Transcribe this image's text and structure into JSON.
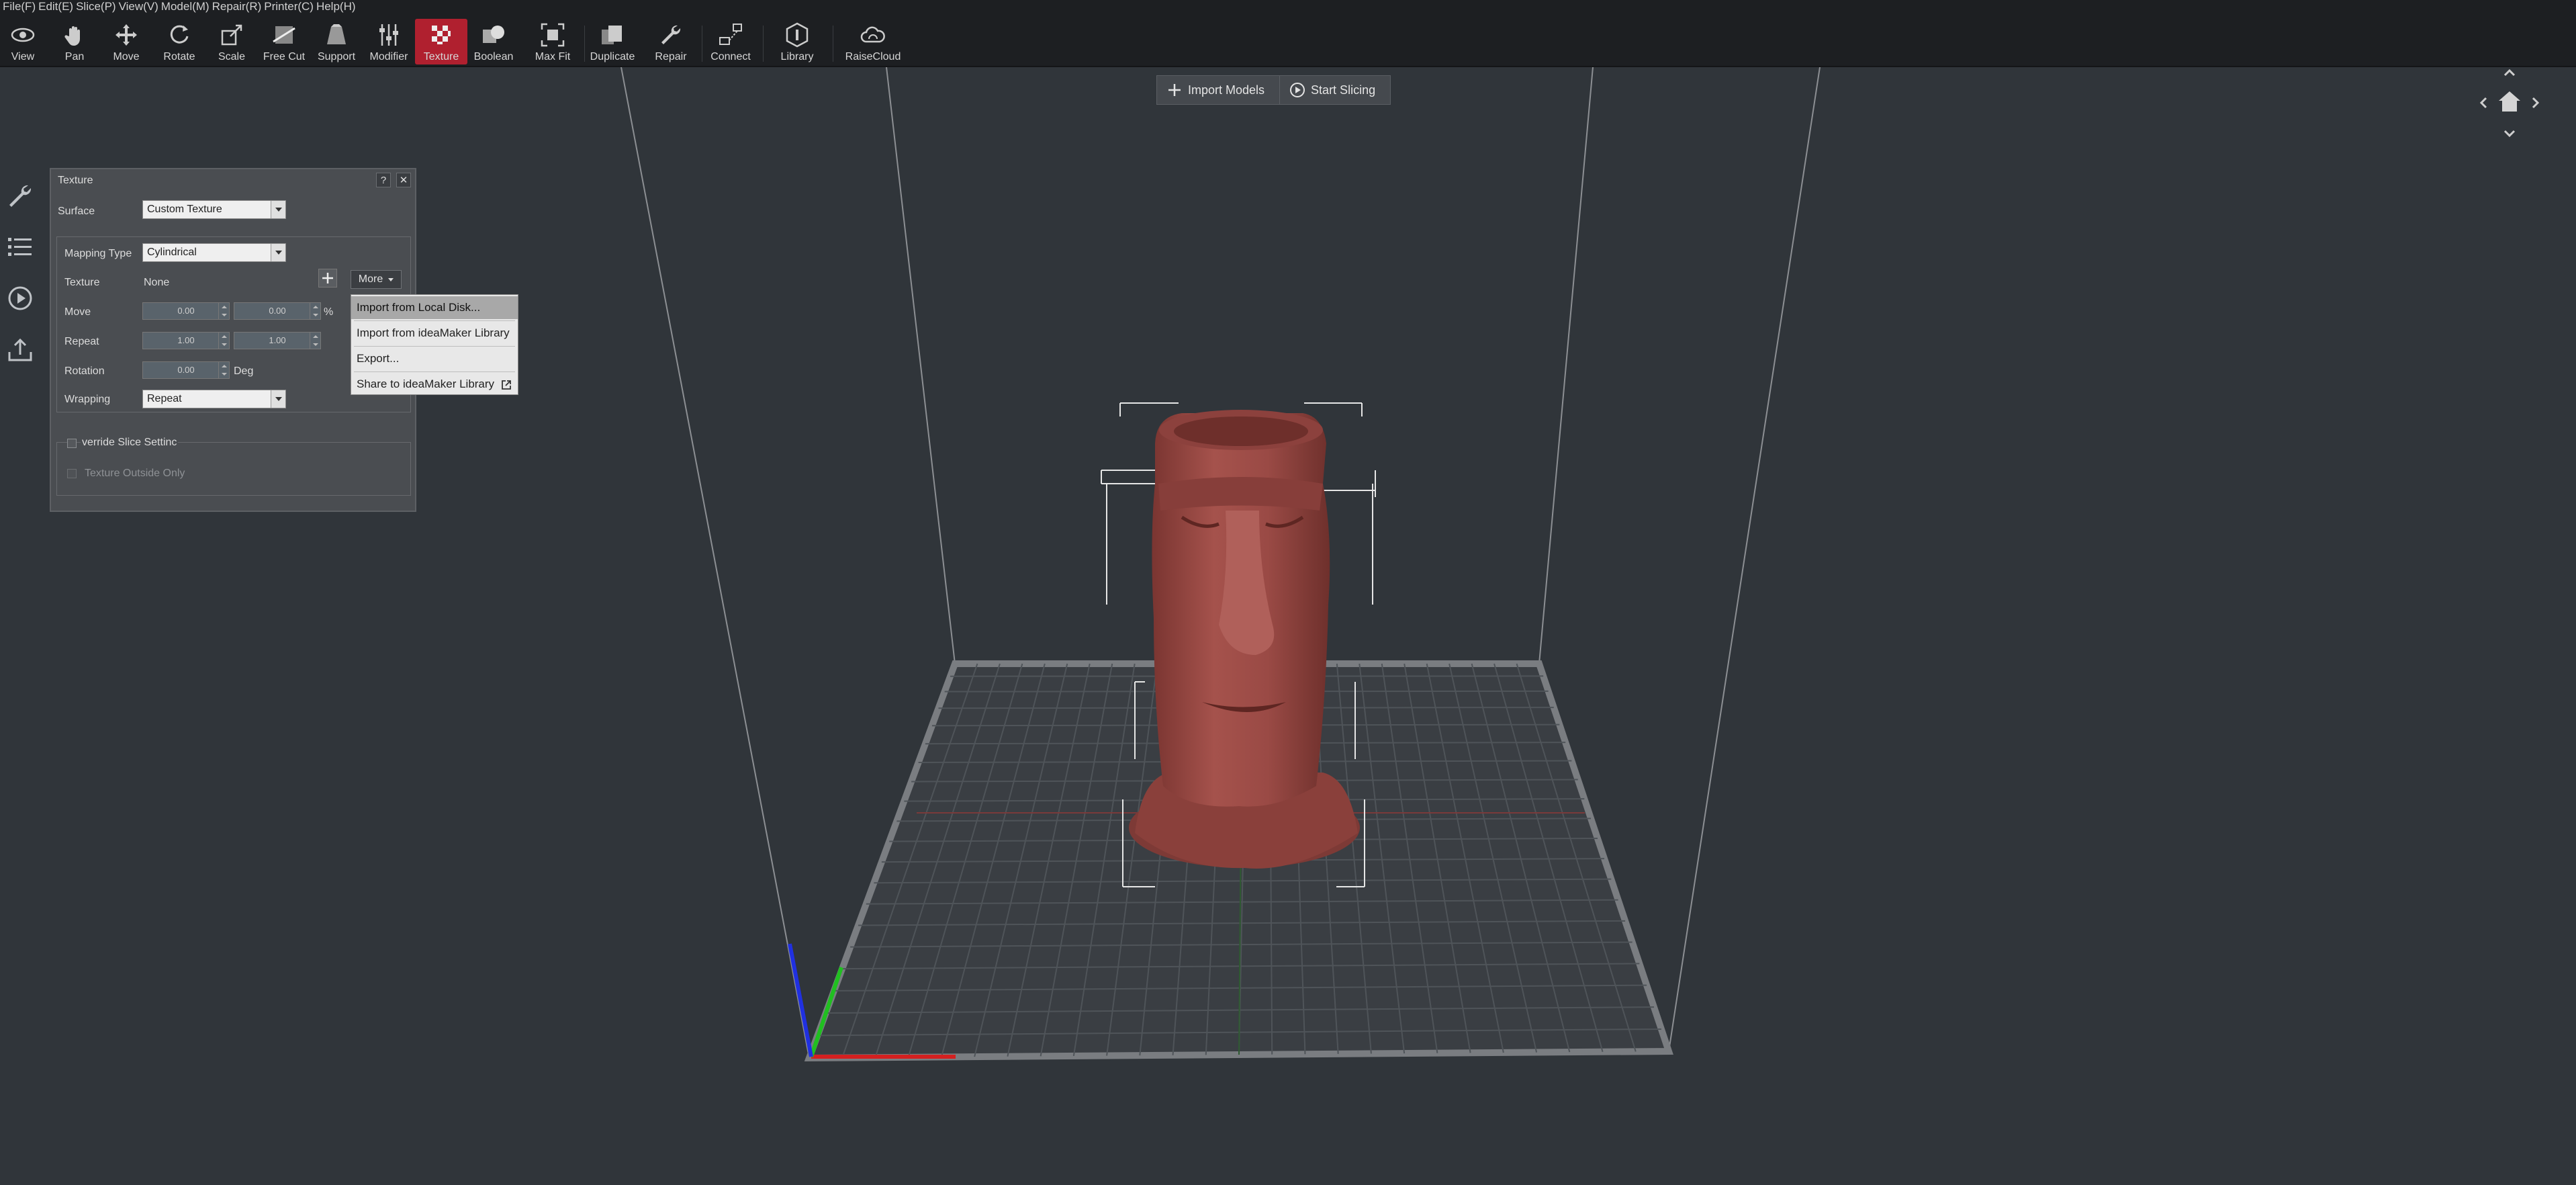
{
  "menu": [
    "File(F)",
    "Edit(E)",
    "Slice(P)",
    "View(V)",
    "Model(M)",
    "Repair(R)",
    "Printer(C)",
    "Help(H)"
  ],
  "toolbar": {
    "view": "View",
    "pan": "Pan",
    "move": "Move",
    "rotate": "Rotate",
    "scale": "Scale",
    "freecut": "Free Cut",
    "support": "Support",
    "modifier": "Modifier",
    "texture": "Texture",
    "boolean": "Boolean",
    "maxfit": "Max Fit",
    "duplicate": "Duplicate",
    "repair": "Repair",
    "connect": "Connect",
    "library": "Library",
    "raisecloud": "RaiseCloud"
  },
  "topbuttons": {
    "import": "Import Models",
    "slice": "Start Slicing"
  },
  "panel": {
    "title": "Texture",
    "help": "?",
    "close": "✕",
    "surface_label": "Surface",
    "surface_value": "Custom Texture",
    "mapping_label": "Mapping Type",
    "mapping_value": "Cylindrical",
    "texture_label": "Texture",
    "texture_value": "None",
    "more": "More",
    "move_label": "Move",
    "move_x": "0.00",
    "move_y": "0.00",
    "move_unit": "%",
    "repeat_label": "Repeat",
    "repeat_x": "1.00",
    "repeat_y": "1.00",
    "rotation_label": "Rotation",
    "rotation_value": "0.00",
    "rotation_unit": "Deg",
    "wrapping_label": "Wrapping",
    "wrapping_value": "Repeat",
    "override_label": "verride Slice Settinc",
    "outside_label": "Texture Outside Only"
  },
  "dropdown": {
    "items": [
      "Import from Local Disk...",
      "Import from ideaMaker Library",
      "Export...",
      "Share to ideaMaker Library"
    ]
  },
  "colors": {
    "accent": "#b0202f",
    "model": "#9a4a45",
    "background": "#30353a"
  }
}
